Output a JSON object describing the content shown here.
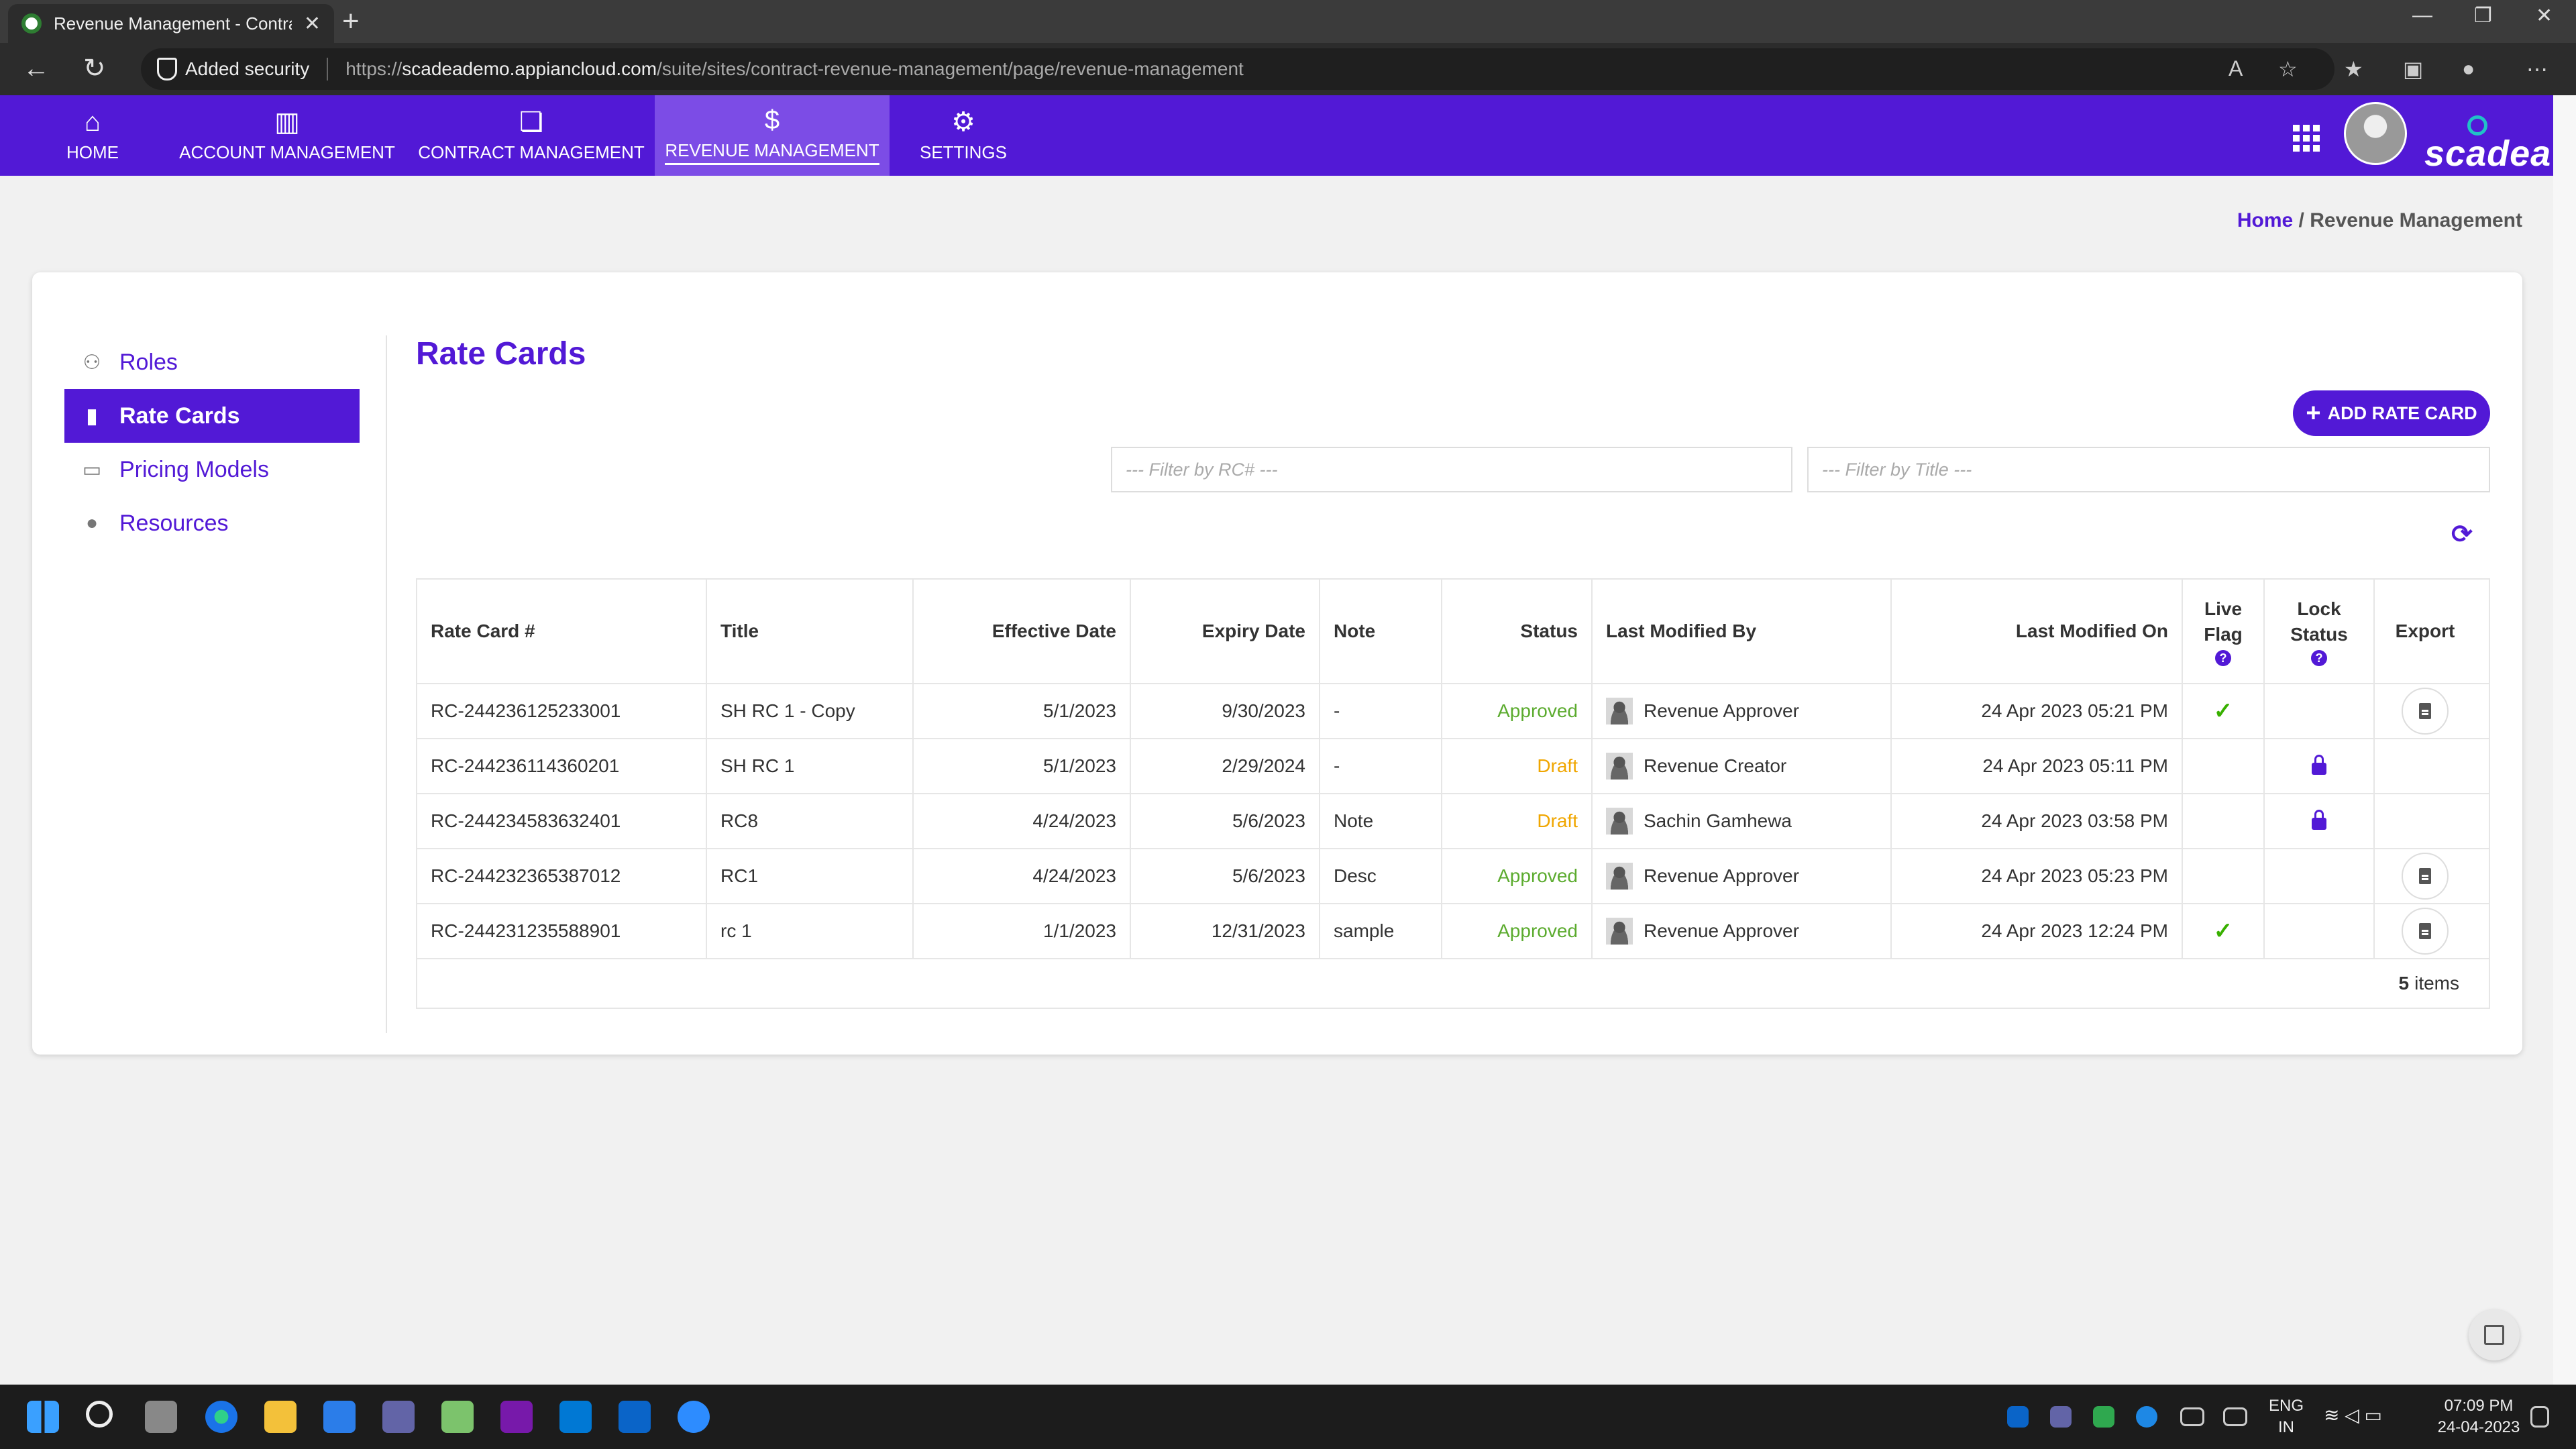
{
  "browser": {
    "tab_title": "Revenue Management - Contrac",
    "new_tab": "+",
    "security_label": "Added security",
    "url_prefix": "https://",
    "url_host": "scadeademo.appiancloud.com",
    "url_path": "/suite/sites/contract-revenue-management/page/revenue-management"
  },
  "header": {
    "nav": [
      {
        "label": "HOME",
        "icon": "home-icon"
      },
      {
        "label": "ACCOUNT MANAGEMENT",
        "icon": "building-icon"
      },
      {
        "label": "CONTRACT MANAGEMENT",
        "icon": "document-icon"
      },
      {
        "label": "REVENUE MANAGEMENT",
        "icon": "dollar-icon",
        "active": true
      },
      {
        "label": "SETTINGS",
        "icon": "gear-icon"
      }
    ],
    "brand": "scadea"
  },
  "breadcrumb": {
    "home": "Home",
    "separator": " / ",
    "current": "Revenue Management"
  },
  "sidebar": {
    "items": [
      {
        "label": "Roles",
        "icon": "roles-icon"
      },
      {
        "label": "Rate Cards",
        "icon": "file-icon",
        "active": true
      },
      {
        "label": "Pricing Models",
        "icon": "money-icon"
      },
      {
        "label": "Resources",
        "icon": "person-icon"
      }
    ]
  },
  "main": {
    "title": "Rate Cards",
    "add_button": "ADD RATE CARD",
    "filter_rc_placeholder": "--- Filter by RC# ---",
    "filter_title_placeholder": "--- Filter by Title ---"
  },
  "table": {
    "columns": [
      "Rate Card #",
      "Title",
      "Effective Date",
      "Expiry Date",
      "Note",
      "Status",
      "Last Modified By",
      "Last Modified On",
      "Live",
      "Flag",
      "Lock",
      "Status",
      "Export"
    ],
    "help_glyph": "?",
    "rows": [
      {
        "rc": "RC-244236125233001",
        "title": "SH RC 1 - Copy",
        "effective": "5/1/2023",
        "expiry": "9/30/2023",
        "note": "-",
        "status": "Approved",
        "modified_by": "Revenue Approver",
        "modified_on": "24 Apr 2023 05:21 PM",
        "live": true,
        "locked": false,
        "export": true
      },
      {
        "rc": "RC-244236114360201",
        "title": "SH RC 1",
        "effective": "5/1/2023",
        "expiry": "2/29/2024",
        "note": "-",
        "status": "Draft",
        "modified_by": "Revenue Creator",
        "modified_on": "24 Apr 2023 05:11 PM",
        "live": false,
        "locked": true,
        "export": false
      },
      {
        "rc": "RC-244234583632401",
        "title": "RC8",
        "effective": "4/24/2023",
        "expiry": "5/6/2023",
        "note": "Note",
        "status": "Draft",
        "modified_by": "Sachin Gamhewa",
        "modified_on": "24 Apr 2023 03:58 PM",
        "live": false,
        "locked": true,
        "export": false
      },
      {
        "rc": "RC-244232365387012",
        "title": "RC1",
        "effective": "4/24/2023",
        "expiry": "5/6/2023",
        "note": "Desc",
        "status": "Approved",
        "modified_by": "Revenue Approver",
        "modified_on": "24 Apr 2023 05:23 PM",
        "live": false,
        "locked": false,
        "export": true
      },
      {
        "rc": "RC-244231235588901",
        "title": "rc 1",
        "effective": "1/1/2023",
        "expiry": "12/31/2023",
        "note": "sample",
        "status": "Approved",
        "modified_by": "Revenue Approver",
        "modified_on": "24 Apr 2023 12:24 PM",
        "live": true,
        "locked": false,
        "export": true
      }
    ],
    "count": "5",
    "count_label": "items"
  },
  "taskbar": {
    "lang": "ENG",
    "region": "IN",
    "time": "07:09 PM",
    "date": "24-04-2023"
  },
  "colors": {
    "brand": "#5219d6",
    "approved": "#5bab2e",
    "draft": "#f0a600"
  }
}
